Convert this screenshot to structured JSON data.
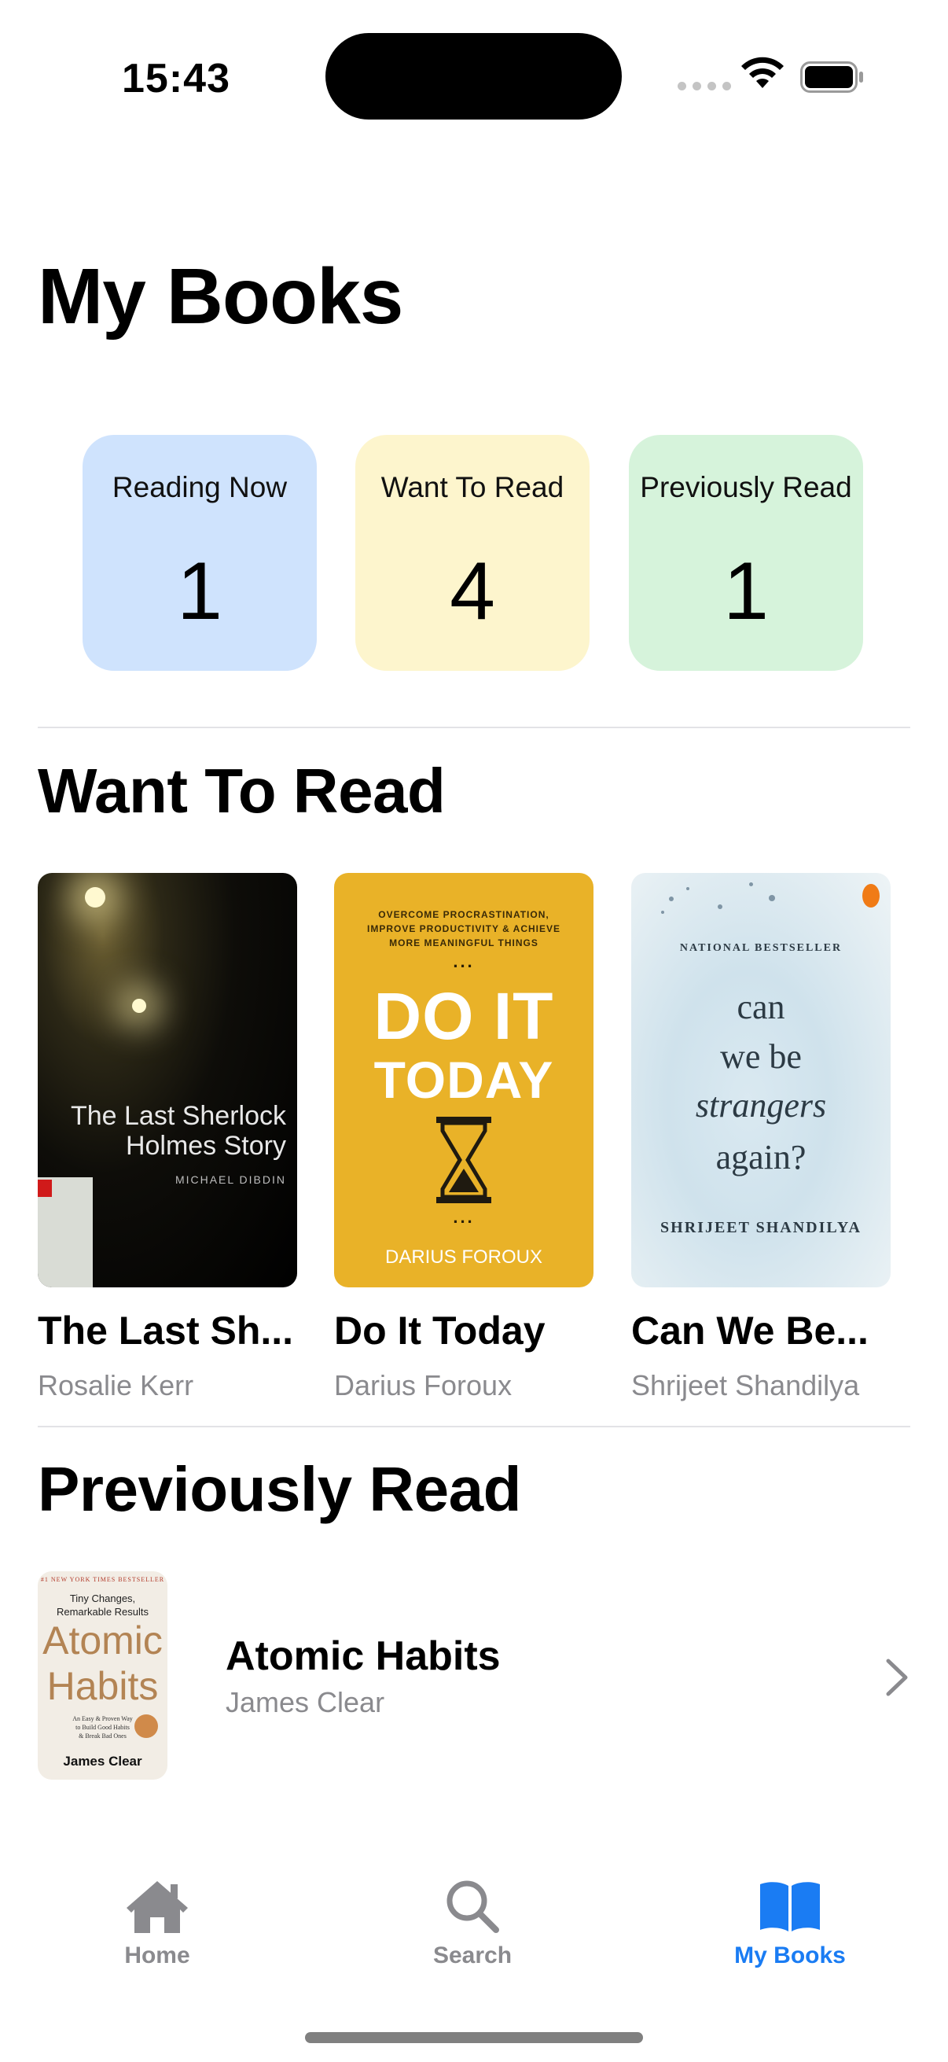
{
  "status_bar": {
    "time": "15:43"
  },
  "page": {
    "title": "My Books"
  },
  "stats": [
    {
      "label": "Reading Now",
      "count": "1",
      "color": "#cfe3fd"
    },
    {
      "label": "Want To Read",
      "count": "4",
      "color": "#fdf5cd"
    },
    {
      "label": "Previously Read",
      "count": "1",
      "color": "#d6f3db"
    }
  ],
  "want_to_read": {
    "section_title": "Want To Read",
    "books": [
      {
        "title": "The Last Sh...",
        "author": "Rosalie Kerr",
        "cover": {
          "title_line1": "The Last Sherlock",
          "title_line2": "Holmes Story",
          "author": "MICHAEL DIBDIN"
        }
      },
      {
        "title": "Do It Today",
        "author": "Darius Foroux",
        "cover": {
          "sub1": "OVERCOME PROCRASTINATION,",
          "sub2": "IMPROVE PRODUCTIVITY & ACHIEVE",
          "sub3": "MORE MEANINGFUL THINGS",
          "big1": "DO IT",
          "big2": "TODAY",
          "author": "DARIUS FOROUX",
          "dots": "..."
        }
      },
      {
        "title": "Can We Be...",
        "author": "Shrijeet Shandilya",
        "cover": {
          "badge": "NATIONAL BESTSELLER",
          "line1": "can",
          "line2": "we be",
          "line3": "strangers",
          "line4": "again?",
          "author": "SHRIJEET SHANDILYA"
        }
      }
    ]
  },
  "previously_read": {
    "section_title": "Previously Read",
    "items": [
      {
        "title": "Atomic Habits",
        "author": "James Clear",
        "cover": {
          "tiny": "#1 NEW YORK TIMES BESTSELLER",
          "sub1": "Tiny Changes,",
          "sub2": "Remarkable Results",
          "big1": "Atomic",
          "big2": "Habits",
          "small1": "An Easy & Proven Way",
          "small2": "to Build Good Habits",
          "small3": "& Break Bad Ones",
          "author": "James Clear"
        }
      }
    ]
  },
  "tab_bar": {
    "items": [
      {
        "label": "Home",
        "icon": "house-icon",
        "active": false
      },
      {
        "label": "Search",
        "icon": "magnifier-icon",
        "active": false
      },
      {
        "label": "My Books",
        "icon": "open-book-icon",
        "active": true
      }
    ],
    "active_color": "#1a7cf3",
    "inactive_color": "#8a8a8e"
  }
}
